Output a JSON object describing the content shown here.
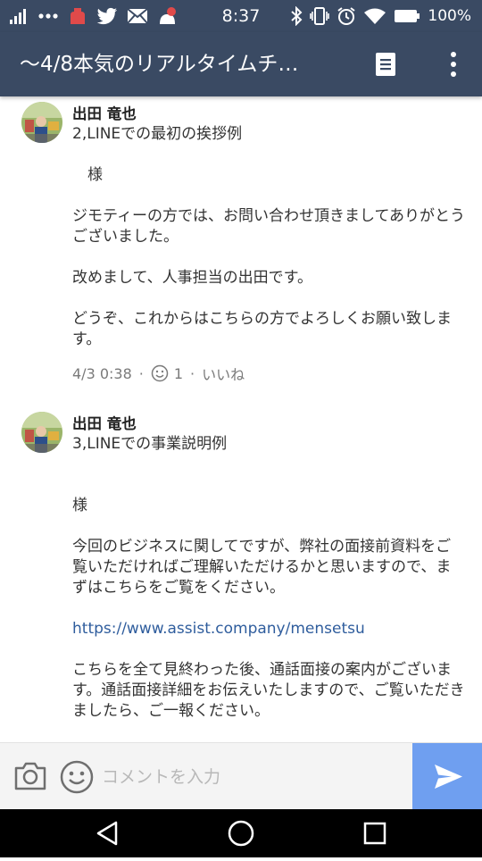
{
  "status_bar": {
    "time": "8:37",
    "battery": "100%",
    "icons": [
      "signal-icon",
      "dots-icon",
      "app-icon",
      "twitter-icon",
      "mail-icon",
      "notification-icon",
      "bluetooth-icon",
      "vibrate-icon",
      "alarm-icon",
      "wifi-icon",
      "battery-icon"
    ]
  },
  "header": {
    "title": "〜4/8本気のリアルタイムチ…",
    "icons": [
      "note-icon",
      "more-vert-icon"
    ],
    "accent": "#3a4a63"
  },
  "posts": [
    {
      "author": "出田 竜也",
      "text": "2,LINEでの最初の挨拶例\n\n　様\n\nジモティーの方では、お問い合わせ頂きましてありがとうございました。\n\n改めまして、人事担当の出田です。\n\nどうぞ、これからはこちらの方でよろしくお願い致します。",
      "date": "4/3 0:38",
      "reaction_count": "1",
      "like_label": "いいね"
    },
    {
      "author": "出田 竜也",
      "text_before_link": "3,LINEでの事業説明例\n\n\n様\n\n今回のビジネスに関してですが、弊社の面接前資料をご覧いただければご理解いただけるかと思いますので、まずはこちらをご覧をください。\n\n",
      "link": "https://www.assist.company/mensetsu",
      "text_after_link": "\n\nこちらを全て見終わった後、通話面接の案内がございます。通話面接詳細をお伝えいたしますので、ご覧いただきましたら、ご一報ください。"
    }
  ],
  "comment_bar": {
    "placeholder": "コメントを入力",
    "send_color": "#6f9ff0",
    "icons": [
      "camera-icon",
      "emoji-icon",
      "send-icon"
    ]
  },
  "nav_bar": {
    "icons": [
      "back-icon",
      "home-icon",
      "recents-icon"
    ]
  }
}
